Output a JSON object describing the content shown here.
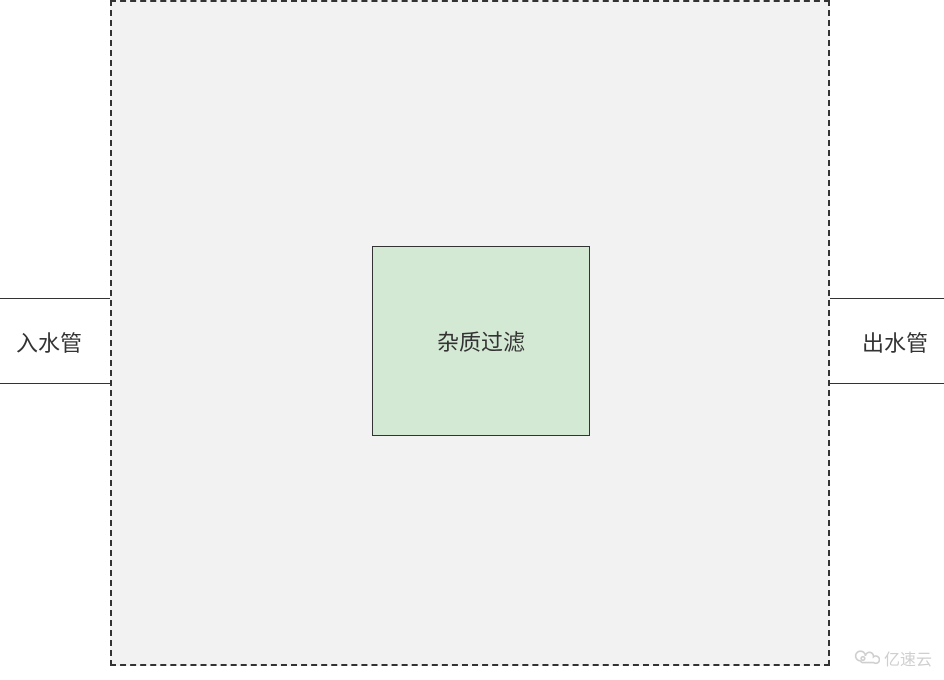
{
  "diagram": {
    "left_label": "入水管",
    "right_label": "出水管",
    "filter_label": "杂质过滤"
  },
  "watermark": {
    "text": "亿速云"
  },
  "colors": {
    "filter_bg": "#d4e9d4",
    "container_bg": "#f2f2f2",
    "border": "#333333"
  }
}
